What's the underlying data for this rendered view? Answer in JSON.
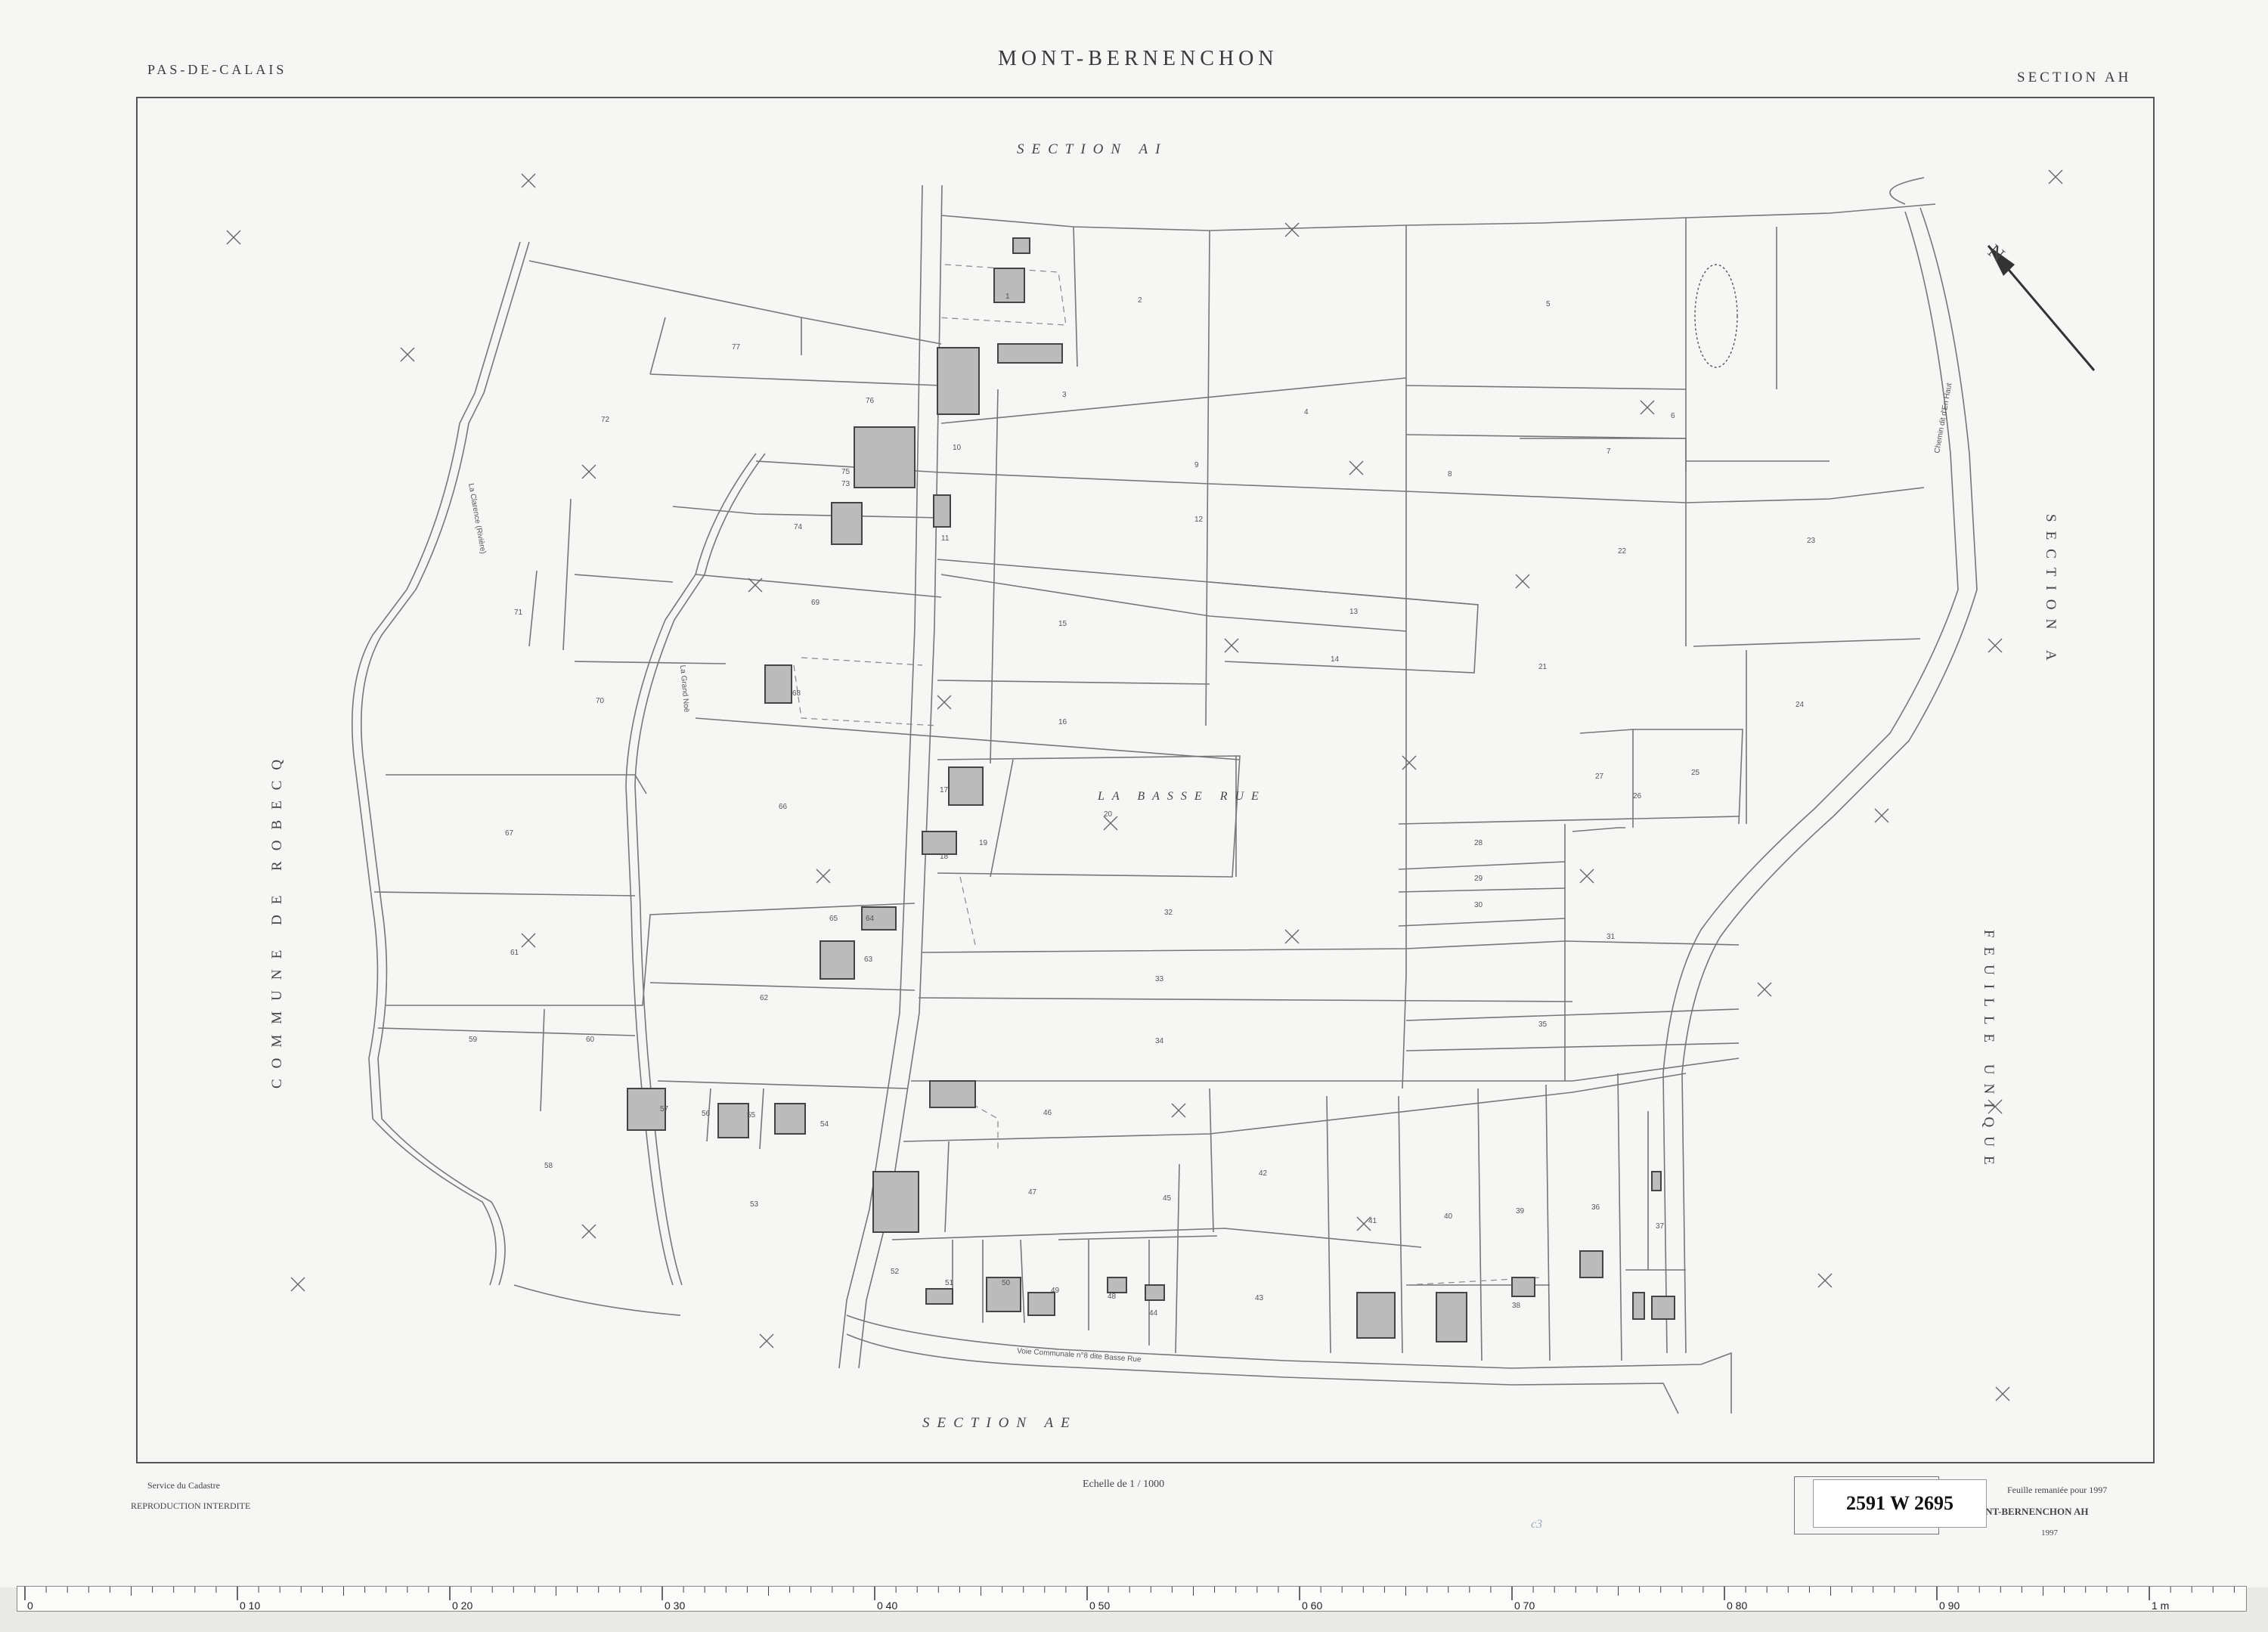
{
  "header": {
    "department": "PAS-DE-CALAIS",
    "commune": "MONT-BERNENCHON",
    "section": "SECTION  AH"
  },
  "map_labels": {
    "north_section": "SECTION AI",
    "south_section": "SECTION AE",
    "east_section": "SECTION A",
    "east_feuille": "FEUILLE UNIQUE",
    "west_commune": "COMMUNE DE ROBECQ",
    "center_place": "LA BASSE RUE",
    "north_arrow": "N",
    "road_1": "Voie Communale n°8 dite Basse Rue",
    "road_2": "Chemin dit d'En Haut",
    "road_3": "La Grand Noë",
    "road_4": "La Clarence (Rivière)"
  },
  "parcels": [
    "1",
    "2",
    "3",
    "4",
    "5",
    "6",
    "7",
    "8",
    "9",
    "10",
    "11",
    "12",
    "13",
    "14",
    "15",
    "16",
    "17",
    "18",
    "19",
    "20",
    "21",
    "22",
    "23",
    "24",
    "25",
    "26",
    "27",
    "28",
    "29",
    "30",
    "31",
    "32",
    "33",
    "34",
    "35",
    "36",
    "37",
    "38",
    "39",
    "40",
    "41",
    "42",
    "43",
    "44",
    "45",
    "46",
    "47",
    "48",
    "49",
    "50",
    "51",
    "52",
    "53",
    "54",
    "55",
    "56",
    "57",
    "58",
    "59",
    "60",
    "61",
    "62",
    "63",
    "64",
    "65",
    "66",
    "67",
    "68",
    "69",
    "70",
    "71",
    "72",
    "73",
    "74",
    "75",
    "76",
    "77"
  ],
  "footer": {
    "service": "Service du Cadastre",
    "reproduction": "REPRODUCTION INTERDITE",
    "scale": "Echelle de 1 / 1000",
    "remaniee": "Feuille remaniée pour 1997",
    "code": "62 0 584 MONT-BERNENCHON AH",
    "year": "1997",
    "handwritten": "c3"
  },
  "archive_label": "2591 W 2695",
  "ruler": {
    "major_marks": [
      "0",
      "0 10",
      "0 20",
      "0 30",
      "0 40",
      "0 50",
      "0 60",
      "0 70",
      "0 80",
      "0 90",
      "1 m"
    ]
  }
}
